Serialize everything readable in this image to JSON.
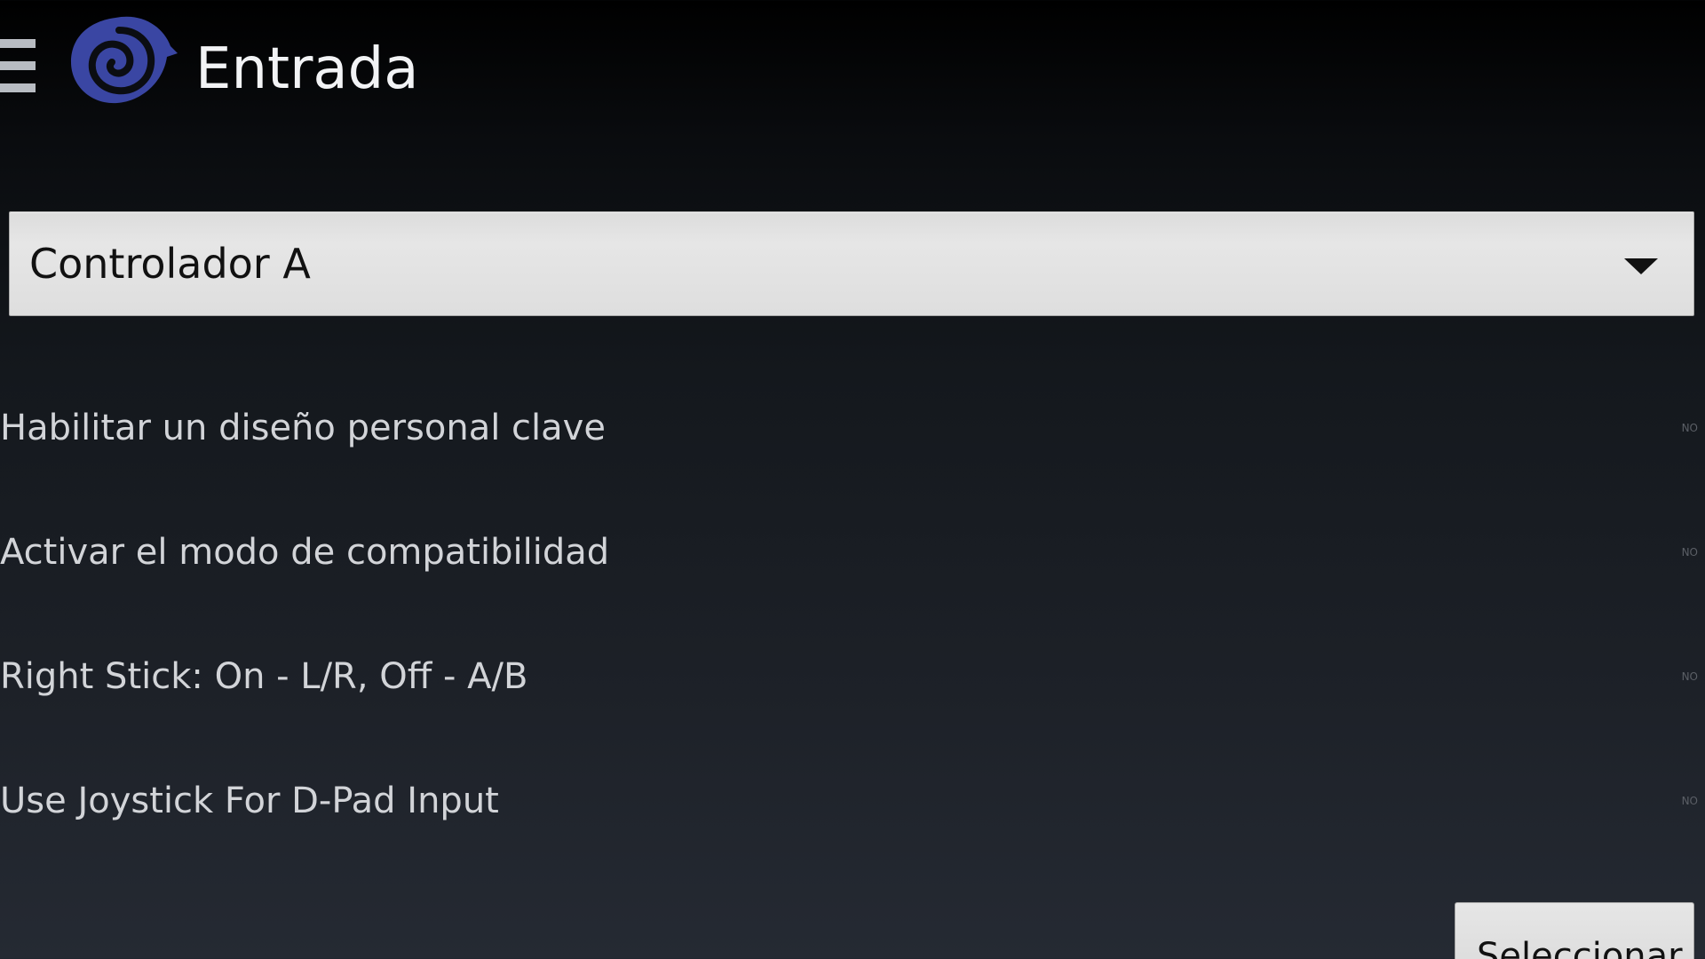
{
  "header": {
    "title": "Entrada",
    "menu_icon": "hamburger-menu-icon",
    "logo": "spiral-logo",
    "logo_color": "#3a46a3"
  },
  "controller_select": {
    "selected": "Controlador A",
    "icon": "chevron-down-icon"
  },
  "settings": [
    {
      "label": "Habilitar un diseño personal clave",
      "state": "NO"
    },
    {
      "label": "Activar el modo de compatibilidad",
      "state": "NO"
    },
    {
      "label": "Right Stick: On - L/R, Off - A/B",
      "state": "NO"
    },
    {
      "label": "Use Joystick For D-Pad Input",
      "state": "NO"
    }
  ],
  "select_button": {
    "label": "Seleccionar"
  }
}
